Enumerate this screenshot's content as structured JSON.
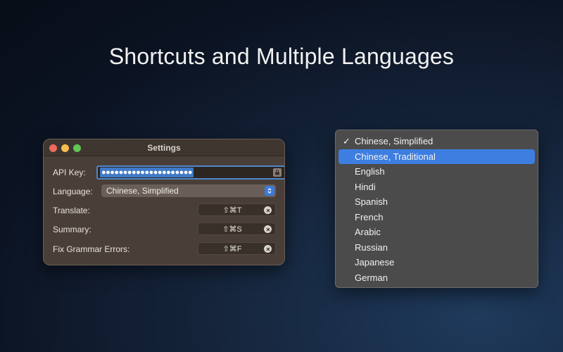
{
  "headline": "Shortcuts and Multiple Languages",
  "settings": {
    "title": "Settings",
    "api_key_label": "API Key:",
    "api_key_value": "●●●●●●●●●●●●●●●●●●●●●",
    "language_label": "Language:",
    "language_value": "Chinese, Simplified",
    "shortcuts": [
      {
        "label": "Translate:",
        "keys": "⇧⌘T"
      },
      {
        "label": "Summary:",
        "keys": "⇧⌘S"
      },
      {
        "label": "Fix Grammar Errors:",
        "keys": "⇧⌘F"
      }
    ]
  },
  "language_menu": {
    "items": [
      {
        "label": "Chinese, Simplified",
        "checked": true
      },
      {
        "label": "Chinese, Traditional",
        "highlighted": true
      },
      {
        "label": "English"
      },
      {
        "label": "Hindi"
      },
      {
        "label": "Spanish"
      },
      {
        "label": "French"
      },
      {
        "label": "Arabic"
      },
      {
        "label": "Russian"
      },
      {
        "label": "Japanese"
      },
      {
        "label": "German"
      }
    ],
    "check_mark": "✓"
  },
  "colors": {
    "accent": "#3d7ee0",
    "window_bg": "#4a3f38",
    "menu_bg": "#4b4b4b"
  }
}
